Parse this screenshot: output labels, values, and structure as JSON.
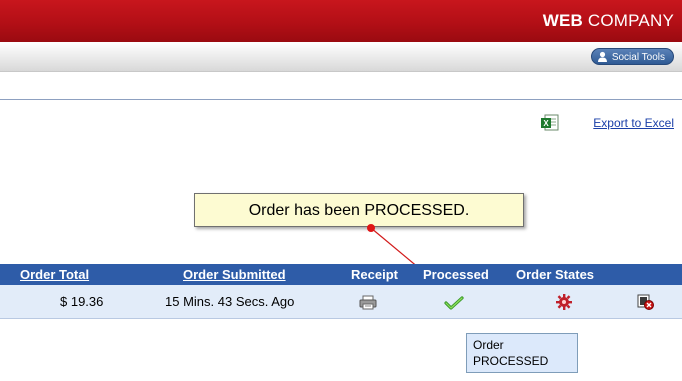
{
  "header": {
    "brand_bold": "WEB",
    "brand_rest": " COMPANY",
    "social_tools_label": "Social Tools"
  },
  "export": {
    "label": "Export to Excel",
    "icon": "excel-icon"
  },
  "callout": {
    "text": "Order has been PROCESSED."
  },
  "table": {
    "headers": {
      "order_total": "Order Total",
      "order_submitted": "Order Submitted",
      "receipt": "Receipt",
      "processed": "Processed",
      "order_states": "Order States"
    },
    "rows": [
      {
        "order_total": "$ 19.36",
        "order_submitted": "15 Mins. 43 Secs. Ago",
        "receipt_icon": "printer-icon",
        "processed_icon": "checkmark-icon",
        "state_icon": "gear-icon",
        "action_icon": "delete-record-icon"
      }
    ]
  },
  "tooltip": {
    "line1": "Order",
    "line2": "PROCESSED"
  },
  "colors": {
    "header_red": "#b30f16",
    "table_header_blue": "#2e5ca8",
    "row_bg": "#e2ecf9",
    "callout_bg": "#fdfbd2",
    "link_blue": "#1a3fa8"
  }
}
